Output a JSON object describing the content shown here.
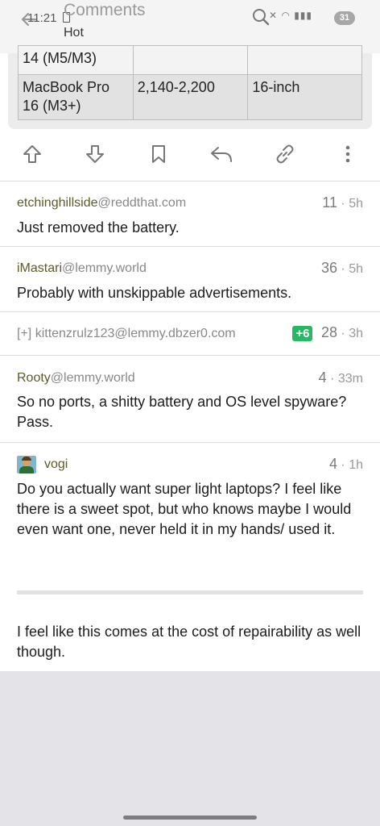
{
  "status": {
    "time": "11:21",
    "battery": "31"
  },
  "header": {
    "title": "Comments",
    "subtitle": "Hot"
  },
  "table": {
    "rows": [
      [
        "14 (M5/M3)",
        "",
        ""
      ],
      [
        "MacBook Pro 16 (M3+)",
        "2,140-2,200",
        "16-inch"
      ]
    ]
  },
  "actions": [
    "upvote-icon",
    "downvote-icon",
    "bookmark-icon",
    "reply-icon",
    "link-icon",
    "more-icon"
  ],
  "comments": [
    {
      "author": "etchinghillside",
      "instance": "@reddthat.com",
      "score": "11",
      "age": "5h",
      "body": "Just removed the battery."
    },
    {
      "author": "iMastari",
      "instance": "@lemmy.world",
      "score": "36",
      "age": "5h",
      "body": "Probably with unskippable advertisements."
    },
    {
      "collapsed_prefix": "[+]",
      "author": "kittenzrulz123",
      "instance": "@lemmy.dbzer0.com",
      "badge": "+6",
      "score": "28",
      "age": "3h"
    },
    {
      "author": "Rooty",
      "instance": "@lemmy.world",
      "score": "4",
      "age": "33m",
      "body": "So no ports, a shitty battery and OS level spyware? Pass."
    },
    {
      "author": "vogi",
      "score": "4",
      "age": "1h",
      "body": "Do you actually want super light laptops? I feel like there is a sweet spot, but who knows maybe I would even want one, never held it in my hands/ used it.",
      "body2": "I feel like this comes at the cost of repairability as well though."
    }
  ],
  "colors": {
    "accent": "#5b5a2a",
    "badge": "#26b865"
  },
  "sep": "·"
}
